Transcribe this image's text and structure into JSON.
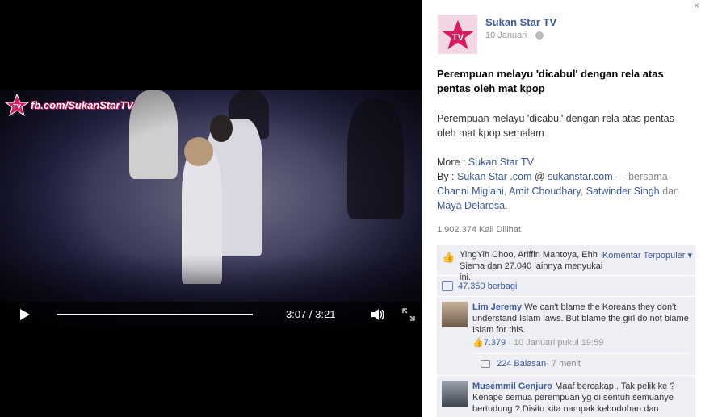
{
  "video": {
    "watermark_text": "fb.com/SukanStarTV",
    "time_display": "3:07 / 3:21",
    "progress_fraction": 0.97
  },
  "post": {
    "page_name": "Sukan Star TV",
    "date": "10 Januari ·",
    "title": "Perempuan melayu 'dicabul' dengan rela atas pentas oleh mat kpop",
    "body": "Perempuan melayu 'dicabul' dengan rela atas pentas oleh mat kpop semalam",
    "more_prefix": "More : ",
    "more_link": "Sukan Star TV",
    "by_prefix": "By : ",
    "by_link1": "Sukan Star .com",
    "by_at": " @ ",
    "by_link2": "sukanstar.com",
    "by_with": " — bersama ",
    "tag1": "Channi Miglani",
    "sep1": ", ",
    "tag2": "Amit Choudhary",
    "sep2": ", ",
    "tag3": "Satwinder Singh",
    "sep3": " dan ",
    "tag4": "Maya Delarosa",
    "end": ".",
    "views": "1.902.374 Kali Dilihat"
  },
  "ufi": {
    "likes_text": "YingYih Choo, Ariffin Mantoya, Ehh Siema dan 27.040 lainnya menyukai ini.",
    "sort_label": "Komentar Terpopuler ▾",
    "shares": "47.350 berbagi",
    "comments": [
      {
        "name": "Lim Jeremy",
        "text": " We can't blame the Koreans they don't understand Islam laws. But blame the girl do not blame Islam for this.",
        "likes": "7.379",
        "meta": " · 10 Januari pukul 19:59",
        "replies": "224 Balasan",
        "replies_time": " · 7 menit"
      },
      {
        "name": "Musemmil Genjuro",
        "text": " Maaf bercakap . Tak pelik ke ? Kenape semua perempuan yg di sentuh semuanye bertudung ? Disitu kita nampak kebodohan dan"
      }
    ]
  },
  "colors": {
    "link": "#3b5998",
    "brand_star": "#d81b60"
  }
}
